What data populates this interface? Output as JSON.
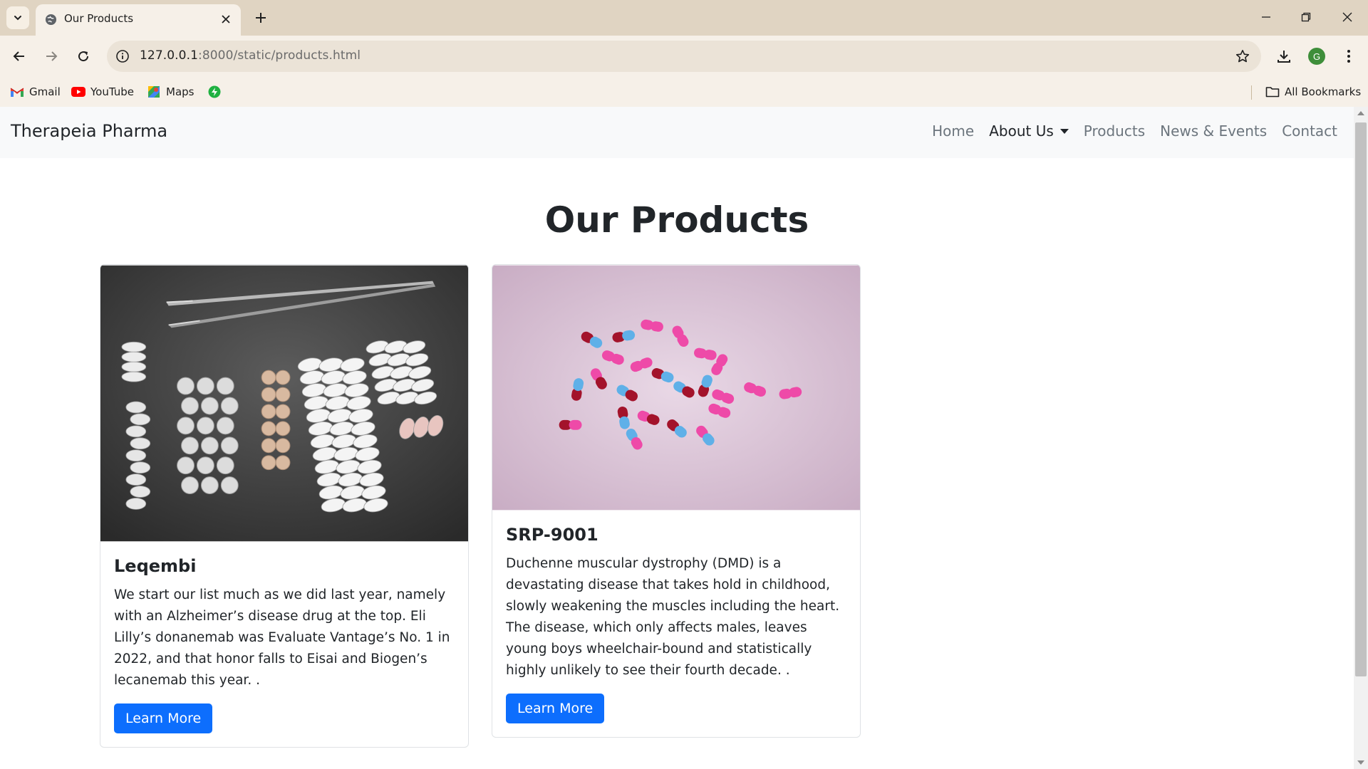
{
  "browser": {
    "tab_title": "Our Products",
    "url_host": "127.0.0.1",
    "url_rest": ":8000/static/products.html",
    "bookmarks": [
      {
        "label": "Gmail",
        "icon": "gmail-icon"
      },
      {
        "label": "YouTube",
        "icon": "youtube-icon"
      },
      {
        "label": "Maps",
        "icon": "maps-icon"
      }
    ],
    "all_bookmarks": "All Bookmarks",
    "profile_initial": "G"
  },
  "site": {
    "brand": "Therapeia Pharma",
    "nav": {
      "home": "Home",
      "about": "About Us",
      "products": "Products",
      "news": "News & Events",
      "contact": "Contact"
    },
    "page_title": "Our Products",
    "products": [
      {
        "title": "Leqembi",
        "description": "We start our list much as we did last year, namely with an Alzheimer’s disease drug at the top. Eli Lilly’s donanemab was Evaluate Vantage’s No. 1 in 2022, and that honor falls to Eisai and Biogen’s lecanemab this year. .",
        "button": "Learn More",
        "image": "tablets-and-tweezers-photo"
      },
      {
        "title": "SRP-9001",
        "description": "Duchenne muscular dystrophy (DMD) is a devastating disease that takes hold in childhood, slowly weakening the muscles including the heart. The disease, which only affects males, leaves young boys wheelchair-bound and statistically highly unlikely to see their fourth decade. .",
        "button": "Learn More",
        "image": "pink-capsules-photo"
      }
    ]
  },
  "colors": {
    "primary": "#0d6efd",
    "navbar_bg": "#f8f9fa",
    "chrome_tabstrip": "#e0d4c2",
    "chrome_toolbar": "#f6f0e8"
  }
}
